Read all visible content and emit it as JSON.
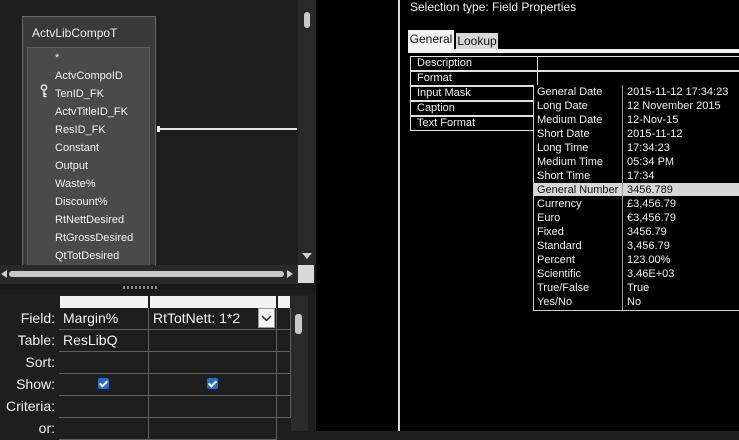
{
  "diagram": {
    "table_title": "ActvLibCompoT",
    "fields": [
      "*",
      "ActvCompoID",
      "TenID_FK",
      "ActvTitleID_FK",
      "ResID_FK",
      "Constant",
      "Output",
      "Waste%",
      "Discount%",
      "RtNettDesired",
      "RtGrossDesired",
      "QtTotDesired"
    ]
  },
  "grid": {
    "row_labels": [
      "Field:",
      "Table:",
      "Sort:",
      "Show:",
      "Criteria:",
      "or:"
    ],
    "columns": [
      {
        "field": "Margin%",
        "table": "ResLibQ",
        "show": true
      },
      {
        "field": "RtTotNett: 1*2",
        "table": "",
        "show": true
      }
    ]
  },
  "property_sheet": {
    "selection_type": "Selection type:  Field Properties",
    "tabs": [
      "General",
      "Lookup"
    ],
    "active_tab": "General",
    "properties": [
      "Description",
      "Format",
      "Input Mask",
      "Caption",
      "Text Format"
    ],
    "format_options": [
      {
        "name": "General Date",
        "sample": "2015-11-12 17:34:23"
      },
      {
        "name": "Long Date",
        "sample": "12 November 2015"
      },
      {
        "name": "Medium Date",
        "sample": "12-Nov-15"
      },
      {
        "name": "Short Date",
        "sample": "2015-11-12"
      },
      {
        "name": "Long Time",
        "sample": "17:34:23"
      },
      {
        "name": "Medium Time",
        "sample": "05:34 PM"
      },
      {
        "name": "Short Time",
        "sample": "17:34"
      },
      {
        "name": "General Number",
        "sample": "3456.789"
      },
      {
        "name": "Currency",
        "sample": "£3,456.79"
      },
      {
        "name": "Euro",
        "sample": "€3,456.79"
      },
      {
        "name": "Fixed",
        "sample": "3456.79"
      },
      {
        "name": "Standard",
        "sample": "3,456.79"
      },
      {
        "name": "Percent",
        "sample": "123.00%"
      },
      {
        "name": "Scientific",
        "sample": "3.46E+03"
      },
      {
        "name": "True/False",
        "sample": "True"
      },
      {
        "name": "Yes/No",
        "sample": "No"
      }
    ],
    "highlighted_format": "General Number"
  },
  "colors": {
    "accent_check": "#1f6ecf",
    "highlight": "#d6d6d6"
  }
}
